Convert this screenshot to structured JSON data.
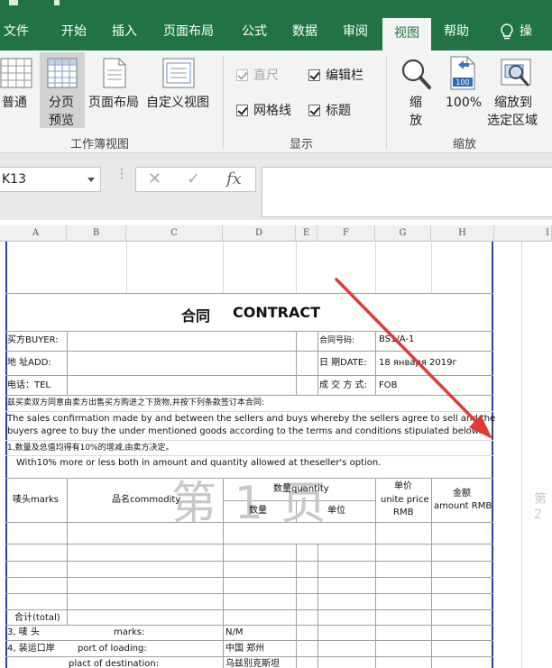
{
  "ribbon_tabs": [
    "文件",
    "开始",
    "插入",
    "页面布局",
    "公式",
    "数据",
    "审阅",
    "视图",
    "帮助",
    "操作"
  ],
  "workbook_views_group": {
    "label": "工作簿视图",
    "normal": "普通",
    "page_break_preview_line1": "分页",
    "page_break_preview_line2": "预览",
    "page_layout": "页面布局",
    "custom_views": "自定义视图"
  },
  "show_group": {
    "label": "显示",
    "ruler": "直尺",
    "formula_bar": "编辑栏",
    "gridlines": "网格线",
    "headings": "标题"
  },
  "zoom_group": {
    "label": "缩放",
    "zoom_line1": "缩",
    "zoom_line2": "放",
    "hundred": "100%",
    "zoom_sel_line1": "缩放到",
    "zoom_sel_line2": "选定区域",
    "hundred_icon_text": "100"
  },
  "formula_bar": {
    "name_box": "K13",
    "fx": "fx",
    "cancel": "✕",
    "enter": "✓",
    "dots": "⋮"
  },
  "columns": [
    "A",
    "B",
    "C",
    "D",
    "E",
    "F",
    "G",
    "H",
    "I"
  ],
  "contract": {
    "title_cn": "合同",
    "title_en": "CONTRACT",
    "buyer": "买方BUYER:",
    "address": "地  址ADD:",
    "tel": "电话：TEL",
    "contract_no_label": "合同号码:",
    "contract_no": "BS1/A-1",
    "date_label": "日  期DATE:",
    "date": "18 января 2019г",
    "terms_label": "成 交 方 式:",
    "terms": "FOB",
    "intro_cn": "兹买卖双方同意由卖方出售买方购进之下货物,并按下列条款签订本合同:",
    "intro_en_1": "The sales confirmation made by and between the sellers and buys whereby the sellers agree to sell and the",
    "intro_en_2": "buyers agree to buy the under mentioned goods according to the terms and conditions stipulated below:",
    "clause1_cn": "1,数量及总值均得有10%的增减,由卖方决定。",
    "clause1_en": "With10% more or less both in amount and quantity allowed at theseller's option.",
    "hdr_marks": "唛头marks",
    "hdr_commodity": "品名commodity",
    "hdr_quantity": "数量quantity",
    "hdr_qty_num": "数量",
    "hdr_unit": "单位",
    "hdr_price_cn": "单价",
    "hdr_price_en1": "unite price",
    "hdr_price_en2": "RMB",
    "hdr_amount_cn": "金额",
    "hdr_amount_en": "amount  RMB",
    "total": "合计(total)",
    "row3_cn": "3, 唛    头",
    "row3_en": "marks:",
    "row3_val": "N/M",
    "row4_cn": "4, 装运口岸",
    "row4_en": "port of  loading:",
    "row4_val": "中国    郑州",
    "row5_en": "plact of destination:",
    "row5_val": "乌兹别克斯坦"
  },
  "page_watermark": "第 1 页",
  "page_watermark_2": "第 2",
  "colors": {
    "excel_green": "#217346",
    "page_border": "#2f3fa1",
    "arrow": "#e03a35"
  }
}
